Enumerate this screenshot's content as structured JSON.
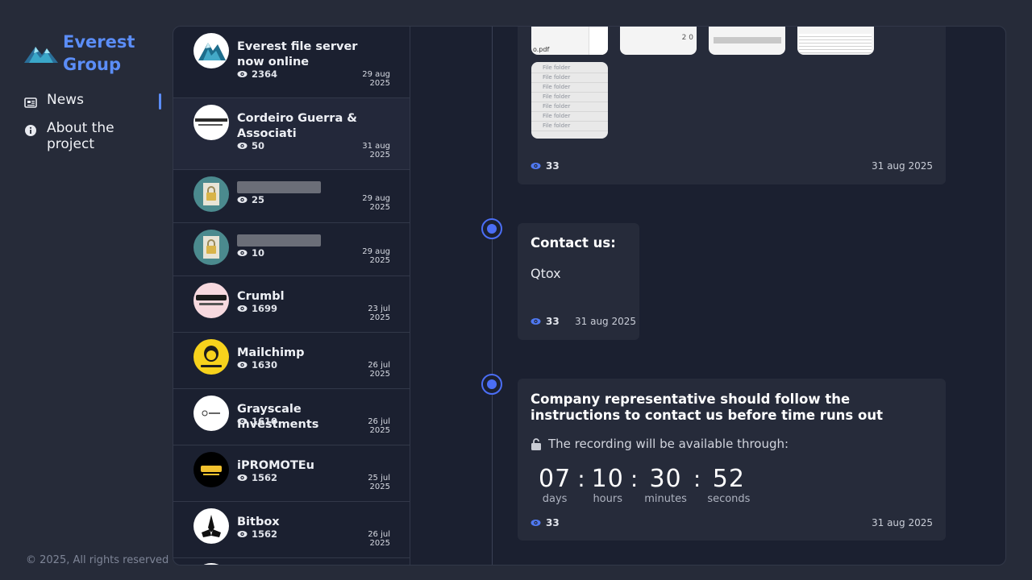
{
  "brand": {
    "name": "Everest Group"
  },
  "nav": [
    {
      "label": "News",
      "icon": "newspaper-icon",
      "active": true
    },
    {
      "label": "About the project",
      "icon": "info-icon",
      "active": false
    }
  ],
  "footer": "© 2025, All rights reserved",
  "list": [
    {
      "title": "Everest file server now online",
      "views": "2364",
      "date": "29 aug 2025",
      "avatar": "everest-logo",
      "blurred": false
    },
    {
      "title": "Cordeiro Guerra & Associati",
      "views": "50",
      "date": "31 aug 2025",
      "avatar": "cordeiro-logo",
      "blurred": false
    },
    {
      "title": "",
      "views": "25",
      "date": "29 aug 2025",
      "avatar": "lock-document",
      "blurred": true
    },
    {
      "title": "",
      "views": "10",
      "date": "29 aug 2025",
      "avatar": "lock-document",
      "blurred": true
    },
    {
      "title": "Crumbl",
      "views": "1699",
      "date": "23 jul 2025",
      "avatar": "crumbl-logo",
      "blurred": false
    },
    {
      "title": "Mailchimp",
      "views": "1630",
      "date": "26 jul 2025",
      "avatar": "mailchimp-logo",
      "blurred": false
    },
    {
      "title": "Grayscale Investments",
      "views": "1610",
      "date": "26 jul 2025",
      "avatar": "grayscale-logo",
      "blurred": false
    },
    {
      "title": "iPROMOTEu",
      "views": "1562",
      "date": "25 jul 2025",
      "avatar": "ipromoteu-logo",
      "blurred": false
    },
    {
      "title": "Bitbox",
      "views": "1562",
      "date": "26 jul 2025",
      "avatar": "bitbox-logo",
      "blurred": false
    }
  ],
  "posts": {
    "files": {
      "thumb_text": [
        "o.pdf",
        "2 0",
        "File folder"
      ],
      "folder_rows": [
        "File folder",
        "File folder",
        "File folder",
        "File folder",
        "File folder",
        "File folder",
        "File folder"
      ],
      "views": "33",
      "date": "31 aug 2025"
    },
    "contact": {
      "title": "Contact us:",
      "text": "Qtox",
      "views": "33",
      "date": "31 aug 2025"
    },
    "countdown": {
      "title": "Company representative should follow the instructions to contact us before time runs out",
      "recording_text": "The recording will be available through:",
      "days": "07",
      "days_label": "days",
      "hours": "10",
      "hours_label": "hours",
      "minutes": "30",
      "minutes_label": "minutes",
      "seconds": "52",
      "seconds_label": "seconds",
      "views": "33",
      "date": "31 aug 2025"
    }
  },
  "colors": {
    "accent": "#5b8df7",
    "timeline": "#4b6ef5",
    "background": "#262b39",
    "panel": "#1b2030"
  }
}
